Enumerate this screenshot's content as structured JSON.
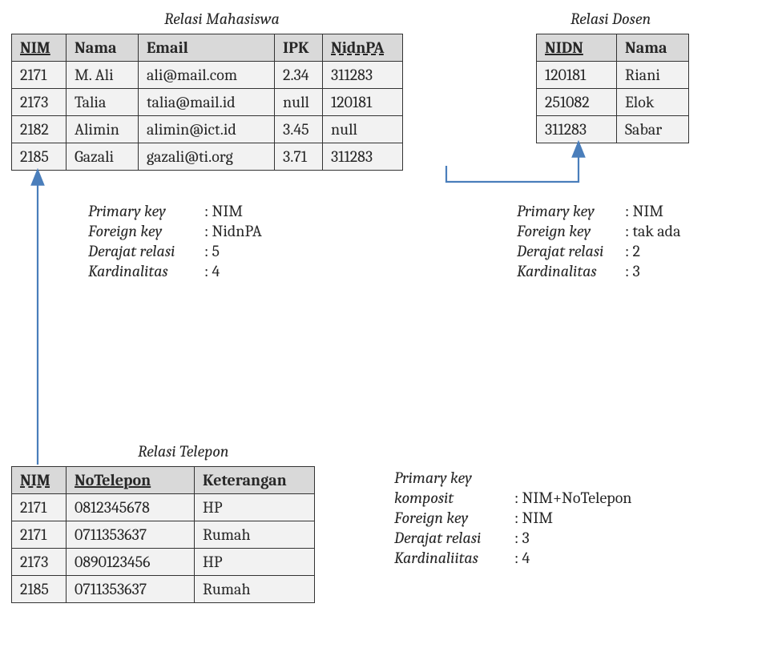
{
  "titles": {
    "mahasiswa": "Relasi Mahasiswa",
    "dosen": "Relasi Dosen",
    "telepon": "Relasi Telepon"
  },
  "mahasiswa": {
    "headers": {
      "nim": "NIM",
      "nama": "Nama",
      "email": "Email",
      "ipk": "IPK",
      "nidnpa": "NidnPA"
    },
    "rows": {
      "0": {
        "nim": "2171",
        "nama": "M. Ali",
        "email": "ali@mail.com",
        "ipk": "2.34",
        "nidnpa": "311283"
      },
      "1": {
        "nim": "2173",
        "nama": "Talia",
        "email": "talia@mail.id",
        "ipk": "null",
        "nidnpa": "120181"
      },
      "2": {
        "nim": "2182",
        "nama": "Alimin",
        "email": "alimin@ict.id",
        "ipk": "3.45",
        "nidnpa": "null"
      },
      "3": {
        "nim": "2185",
        "nama": "Gazali",
        "email": "gazali@ti.org",
        "ipk": "3.71",
        "nidnpa": "311283"
      }
    },
    "meta": {
      "pk_label": "Primary key",
      "pk_val": ": NIM",
      "fk_label": "Foreign key",
      "fk_val": ": NidnPA",
      "deg_label": "Derajat relasi",
      "deg_val": ": 5",
      "card_label": "Kardinalitas",
      "card_val": ": 4"
    }
  },
  "dosen": {
    "headers": {
      "nidn": "NIDN",
      "nama": "Nama"
    },
    "rows": {
      "0": {
        "nidn": "120181",
        "nama": "Riani"
      },
      "1": {
        "nidn": "251082",
        "nama": "Elok"
      },
      "2": {
        "nidn": "311283",
        "nama": "Sabar"
      }
    },
    "meta": {
      "pk_label": "Primary key",
      "pk_val": ": NIM",
      "fk_label": "Foreign key",
      "fk_val": ": tak ada",
      "deg_label": "Derajat relasi",
      "deg_val": ": 2",
      "card_label": "Kardinalitas",
      "card_val": ": 3"
    }
  },
  "telepon": {
    "headers": {
      "nim": "NIM",
      "notelepon": "NoTelepon",
      "keterangan": "Keterangan"
    },
    "rows": {
      "0": {
        "nim": "2171",
        "notelepon": "0812345678",
        "keterangan": "HP"
      },
      "1": {
        "nim": "2171",
        "notelepon": "0711353637",
        "keterangan": "Rumah"
      },
      "2": {
        "nim": "2173",
        "notelepon": "0890123456",
        "keterangan": "HP"
      },
      "3": {
        "nim": "2185",
        "notelepon": "0711353637",
        "keterangan": "Rumah"
      }
    },
    "meta": {
      "pk_label": "Primary key",
      "pk_label2": "komposit",
      "pk_val": ": NIM+NoTelepon",
      "fk_label": "Foreign key",
      "fk_val": ": NIM",
      "deg_label": "Derajat relasi",
      "deg_val": ": 3",
      "card_label": "Kardinaliitas",
      "card_val": ": 4"
    }
  },
  "colors": {
    "arrow": "#4a7ebb"
  }
}
